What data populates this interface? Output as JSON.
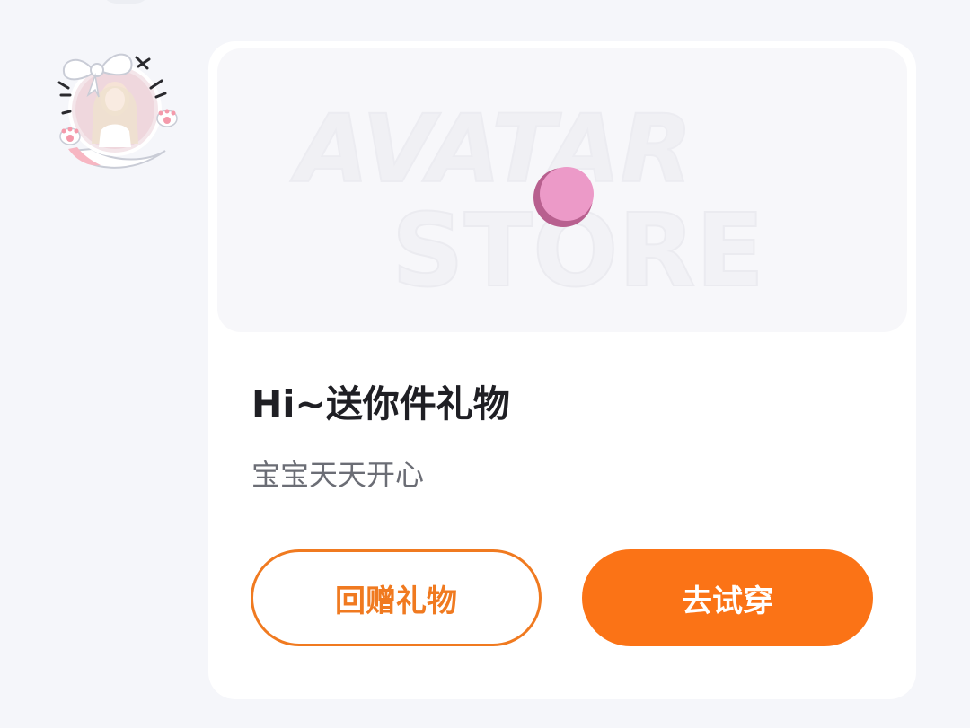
{
  "message": {
    "banner": {
      "watermark_line1": "AVATAR",
      "watermark_line2": "STORE"
    },
    "title": "Hi~送你件礼物",
    "subtitle": "宝宝天天开心",
    "buttons": {
      "return_gift_label": "回赠礼物",
      "try_on_label": "去试穿"
    }
  },
  "colors": {
    "accent": "#fb7316",
    "accent_outline": "#f07a20",
    "page_background": "#f5f6fa",
    "card_background": "#ffffff",
    "ball": "#ec9ac8"
  },
  "icons": {
    "avatar": "avatar-with-bow-and-cat-frame",
    "banner_ball": "pink-ball-icon"
  }
}
